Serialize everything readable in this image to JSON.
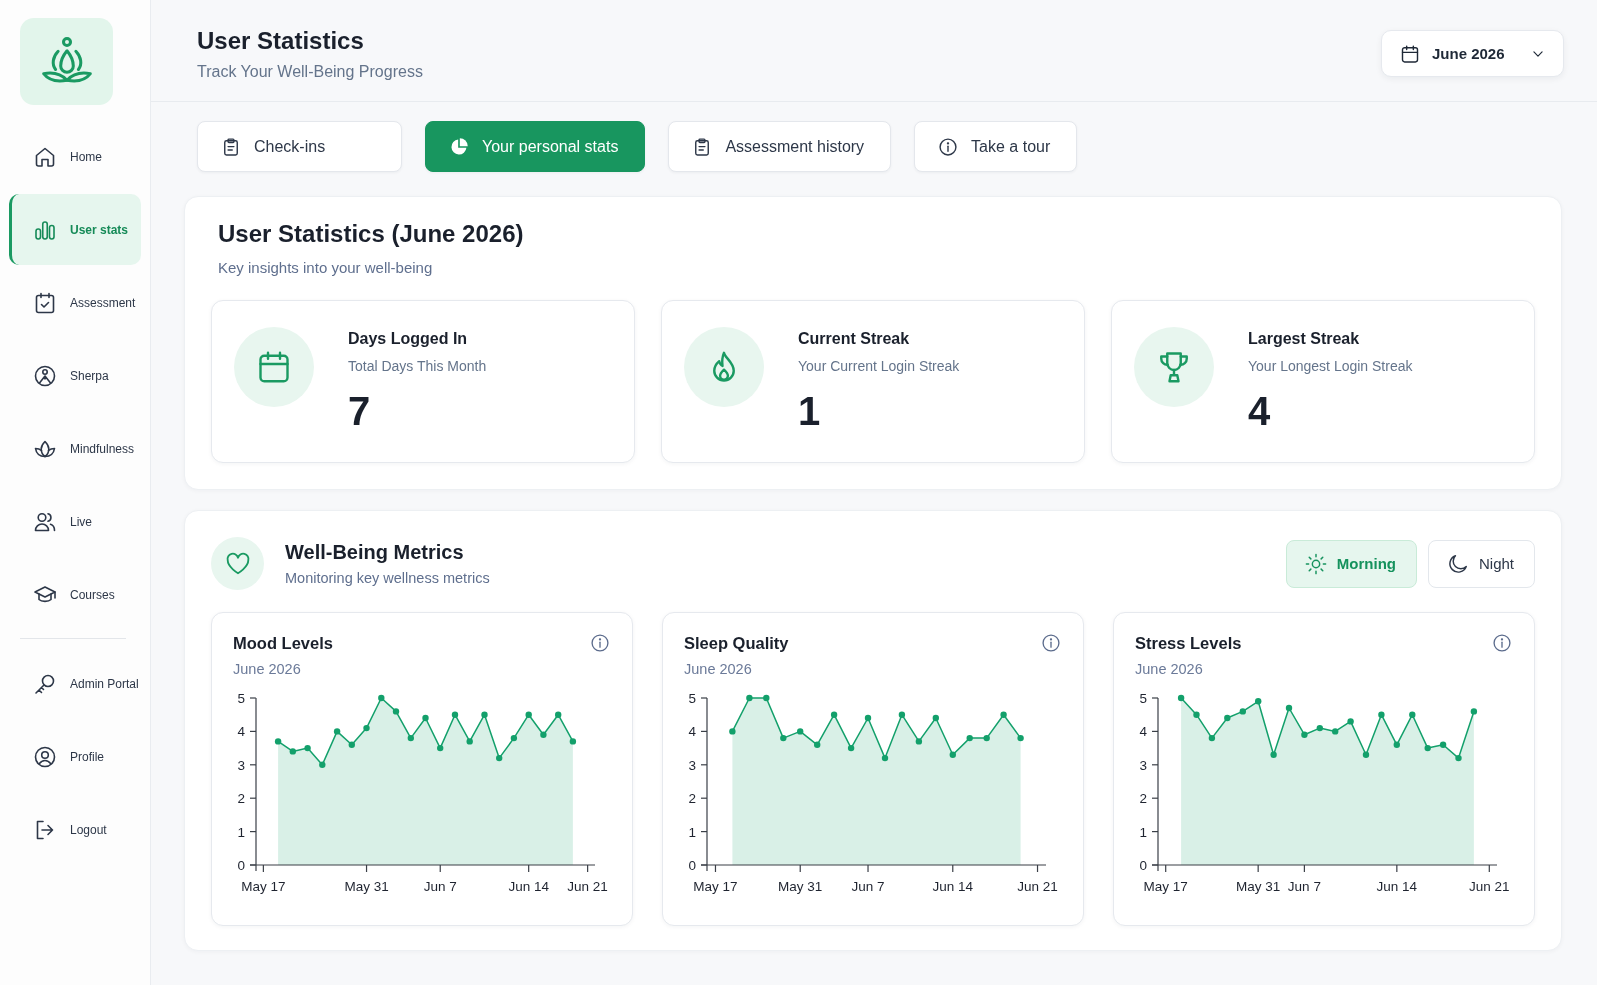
{
  "sidebar": {
    "nav_items": [
      {
        "label": "Home",
        "selected": false
      },
      {
        "label": "User stats",
        "selected": true
      },
      {
        "label": "Assessment",
        "selected": false
      },
      {
        "label": "Sherpa",
        "selected": false
      },
      {
        "label": "Mindfulness",
        "selected": false
      },
      {
        "label": "Live",
        "selected": false
      },
      {
        "label": "Courses",
        "selected": false
      }
    ],
    "account_items": [
      {
        "label": "Admin Portal",
        "selected": false
      },
      {
        "label": "Profile",
        "selected": false
      },
      {
        "label": "Logout",
        "selected": false
      }
    ]
  },
  "header": {
    "title": "User Statistics",
    "subtitle": "Track Your Well-Being Progress",
    "date_picker": {
      "value": "June 2026"
    }
  },
  "tabs": [
    {
      "label": "Check-ins",
      "selected": false
    },
    {
      "label": "Your personal stats",
      "selected": true
    },
    {
      "label": "Assessment history",
      "selected": false
    },
    {
      "label": "Take a tour",
      "selected": false
    }
  ],
  "summary": {
    "title": "User Statistics (June 2026)",
    "subtitle": "Key insights into your well-being",
    "cards": [
      {
        "title": "Days Logged In",
        "subtitle": "Total Days This Month",
        "value": "7"
      },
      {
        "title": "Current Streak",
        "subtitle": "Your Current Login Streak",
        "value": "1"
      },
      {
        "title": "Largest Streak",
        "subtitle": "Your Longest Login Streak",
        "value": "4"
      }
    ]
  },
  "metrics": {
    "title": "Well-Being Metrics",
    "subtitle": "Monitoring key wellness metrics",
    "time_toggle": [
      {
        "label": "Morning",
        "selected": true
      },
      {
        "label": "Night",
        "selected": false
      }
    ],
    "charts": [
      {
        "chart_data": {
          "type": "area",
          "title": "Mood Levels",
          "subtitle": "June 2026",
          "marker": "circle",
          "color": "#13a06b",
          "ylim": [
            0,
            5
          ],
          "yticks": [
            0,
            1,
            2,
            3,
            4,
            5
          ],
          "categories": [
            "May 17",
            null,
            null,
            null,
            null,
            null,
            null,
            "May 31",
            null,
            null,
            null,
            null,
            "Jun 7",
            null,
            null,
            null,
            null,
            null,
            "Jun 14",
            null,
            null,
            null,
            "Jun 21"
          ],
          "values": [
            null,
            3.7,
            3.4,
            3.5,
            3.0,
            4.0,
            3.6,
            4.1,
            5.0,
            4.6,
            3.8,
            4.4,
            3.5,
            4.5,
            3.7,
            4.5,
            3.2,
            3.8,
            4.5,
            3.9,
            4.5,
            3.7,
            null
          ]
        }
      },
      {
        "chart_data": {
          "type": "area",
          "title": "Sleep Quality",
          "subtitle": "June 2026",
          "marker": "circle",
          "color": "#13a06b",
          "ylim": [
            0,
            5
          ],
          "yticks": [
            0,
            1,
            2,
            3,
            4,
            5
          ],
          "categories": [
            "May 17",
            null,
            null,
            null,
            null,
            "May 31",
            null,
            null,
            null,
            "Jun 7",
            null,
            null,
            null,
            null,
            "Jun 14",
            null,
            null,
            null,
            null,
            "Jun 21"
          ],
          "values": [
            null,
            4.0,
            5.0,
            5.0,
            3.8,
            4.0,
            3.6,
            4.5,
            3.5,
            4.4,
            3.2,
            4.5,
            3.7,
            4.4,
            3.3,
            3.8,
            3.8,
            4.5,
            3.8,
            null
          ]
        }
      },
      {
        "chart_data": {
          "type": "area",
          "title": "Stress Levels",
          "subtitle": "June 2026",
          "marker": "circle",
          "color": "#13a06b",
          "ylim": [
            0,
            5
          ],
          "yticks": [
            0,
            1,
            2,
            3,
            4,
            5
          ],
          "categories": [
            "May 17",
            null,
            null,
            null,
            null,
            null,
            "May 31",
            null,
            null,
            "Jun 7",
            null,
            null,
            null,
            null,
            null,
            "Jun 14",
            null,
            null,
            null,
            null,
            null,
            "Jun 21"
          ],
          "values": [
            null,
            5.0,
            4.5,
            3.8,
            4.4,
            4.6,
            4.9,
            3.3,
            4.7,
            3.9,
            4.1,
            4.0,
            4.3,
            3.3,
            4.5,
            3.6,
            4.5,
            3.5,
            3.6,
            3.2,
            4.6,
            null
          ]
        }
      }
    ]
  }
}
